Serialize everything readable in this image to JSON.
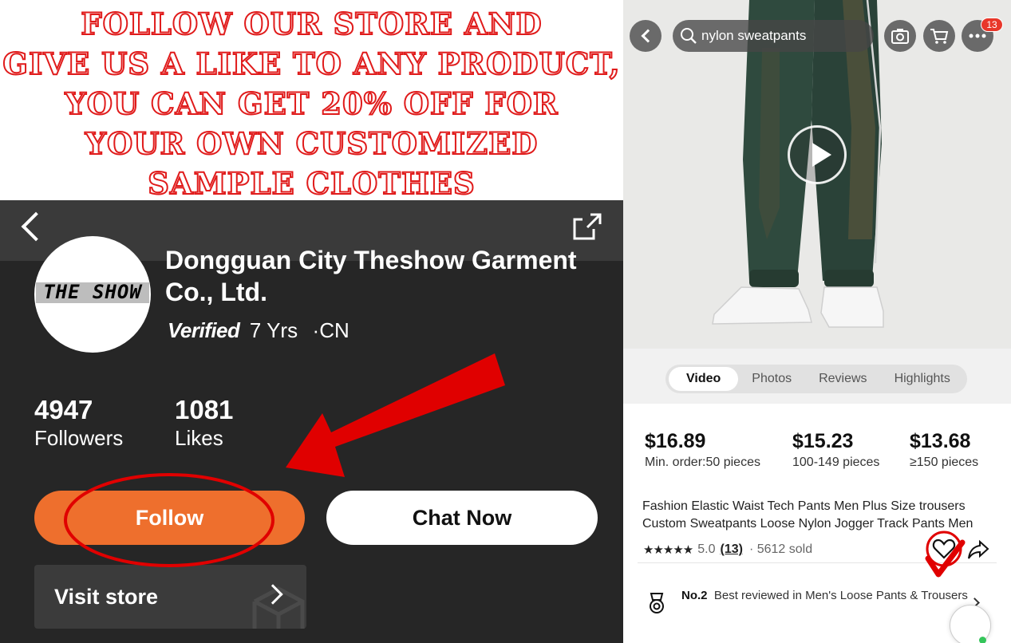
{
  "banner": {
    "lines": [
      "FOLLOW OUR STORE AND",
      "GIVE US A LIKE TO ANY PRODUCT,",
      "YOU CAN GET 20% OFF FOR",
      "YOUR OWN CUSTOMIZED",
      "SAMPLE CLOTHES"
    ]
  },
  "store": {
    "logo_text": "THE SHOW",
    "name": "Dongguan City Theshow Garment Co., Ltd.",
    "verified_label": "Verified",
    "years": "7 Yrs",
    "country": "·CN",
    "stats": [
      {
        "value": "4947",
        "label": "Followers"
      },
      {
        "value": "1081",
        "label": "Likes"
      }
    ],
    "follow_label": "Follow",
    "chat_label": "Chat Now",
    "visit_label": "Visit store"
  },
  "product": {
    "search_text": "nylon sweatpants",
    "cart_badge": "13",
    "tabs": [
      "Video",
      "Photos",
      "Reviews",
      "Highlights"
    ],
    "active_tab": "Video",
    "prices": [
      {
        "amount": "$16.89",
        "tier": "Min. order:50 pieces"
      },
      {
        "amount": "$15.23",
        "tier": "100-149 pieces"
      },
      {
        "amount": "$13.68",
        "tier": "≥150 pieces"
      }
    ],
    "title": "Fashion Elastic Waist Tech Pants Men Plus Size trousers Custom Sweatpants Loose Nylon Jogger Track Pants Men",
    "stars": "★★★★★",
    "rating": "5.0",
    "review_count": "(13)",
    "sold": "· 5612 sold",
    "rank_no": "No.2",
    "rank_text": "Best reviewed in Men's Loose Pants & Trousers"
  },
  "colors": {
    "banner_text": "#e01b1b",
    "follow_button": "#ee6f2d",
    "annotation": "#e00000",
    "store_background": "#262626"
  },
  "icons": [
    "back-icon",
    "share-icon",
    "search-icon",
    "camera-icon",
    "cart-icon",
    "more-icon",
    "play-icon",
    "heart-icon",
    "ranking-icon",
    "chevron-right-icon"
  ]
}
